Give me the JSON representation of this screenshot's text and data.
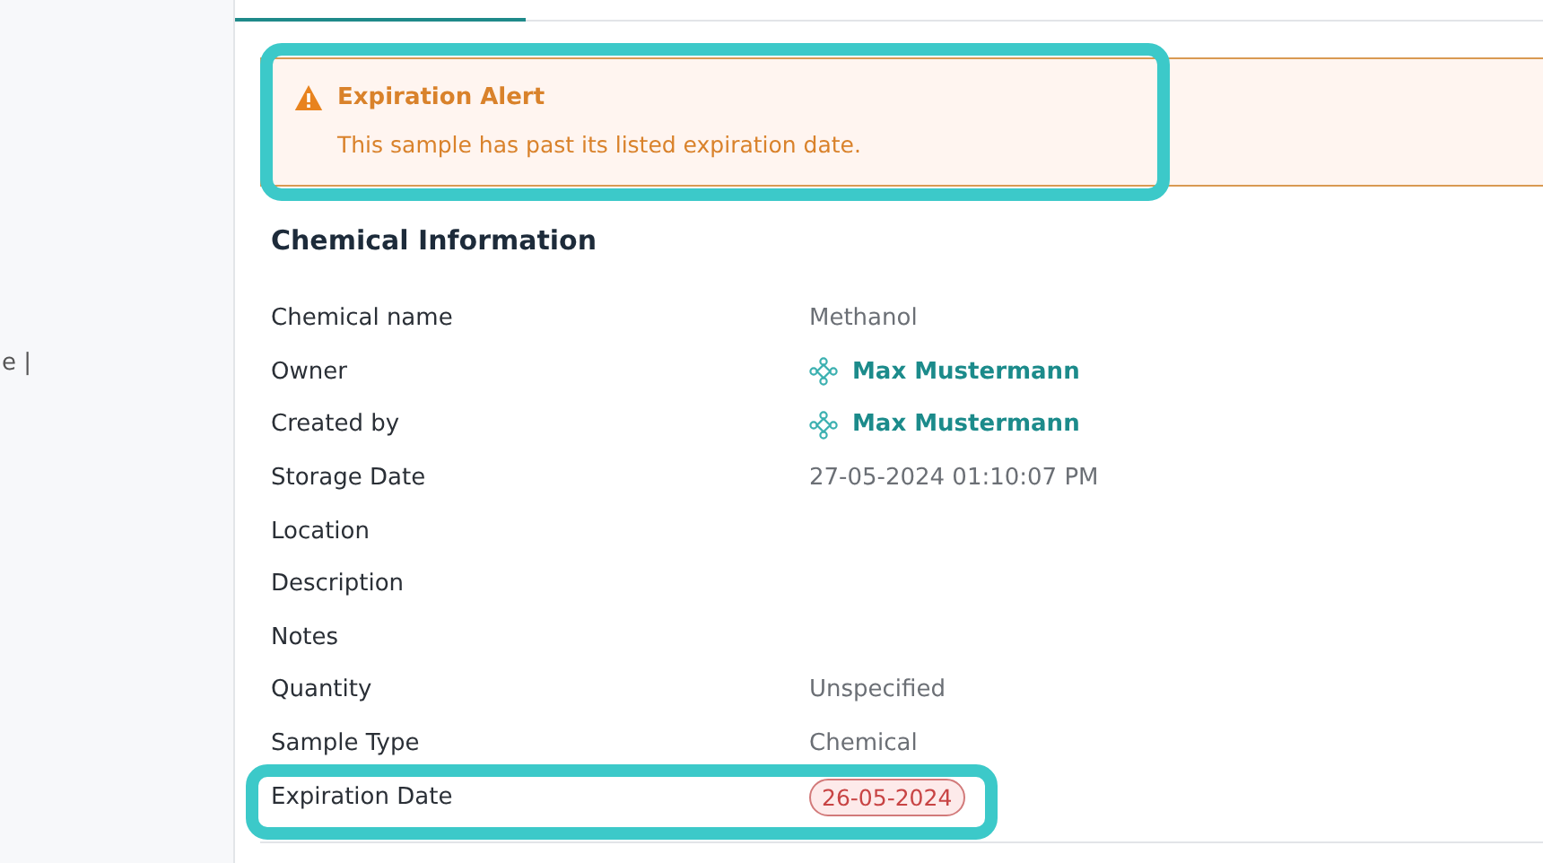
{
  "sidebar": {
    "fragment": "e |"
  },
  "tabs": [
    {
      "selected": true
    }
  ],
  "alert": {
    "title": "Expiration Alert",
    "message": "This sample has past its listed expiration date.",
    "highlighted": true
  },
  "section": {
    "title": "Chemical Information"
  },
  "fields": [
    {
      "label": "Chemical name",
      "kind": "text",
      "value": "Methanol",
      "highlighted": false
    },
    {
      "label": "Owner",
      "kind": "user",
      "value": "Max Mustermann",
      "highlighted": false
    },
    {
      "label": "Created by",
      "kind": "user",
      "value": "Max Mustermann",
      "highlighted": false
    },
    {
      "label": "Storage Date",
      "kind": "text",
      "value": "27-05-2024 01:10:07 PM",
      "highlighted": false
    },
    {
      "label": "Location",
      "kind": "empty",
      "highlighted": false
    },
    {
      "label": "Description",
      "kind": "empty",
      "highlighted": false
    },
    {
      "label": "Notes",
      "kind": "empty",
      "highlighted": false
    },
    {
      "label": "Quantity",
      "kind": "text",
      "value": "Unspecified",
      "highlighted": false
    },
    {
      "label": "Sample Type",
      "kind": "text",
      "value": "Chemical",
      "highlighted": false
    },
    {
      "label": "Expiration Date",
      "kind": "badge",
      "value": "26-05-2024",
      "highlighted": true
    }
  ]
}
